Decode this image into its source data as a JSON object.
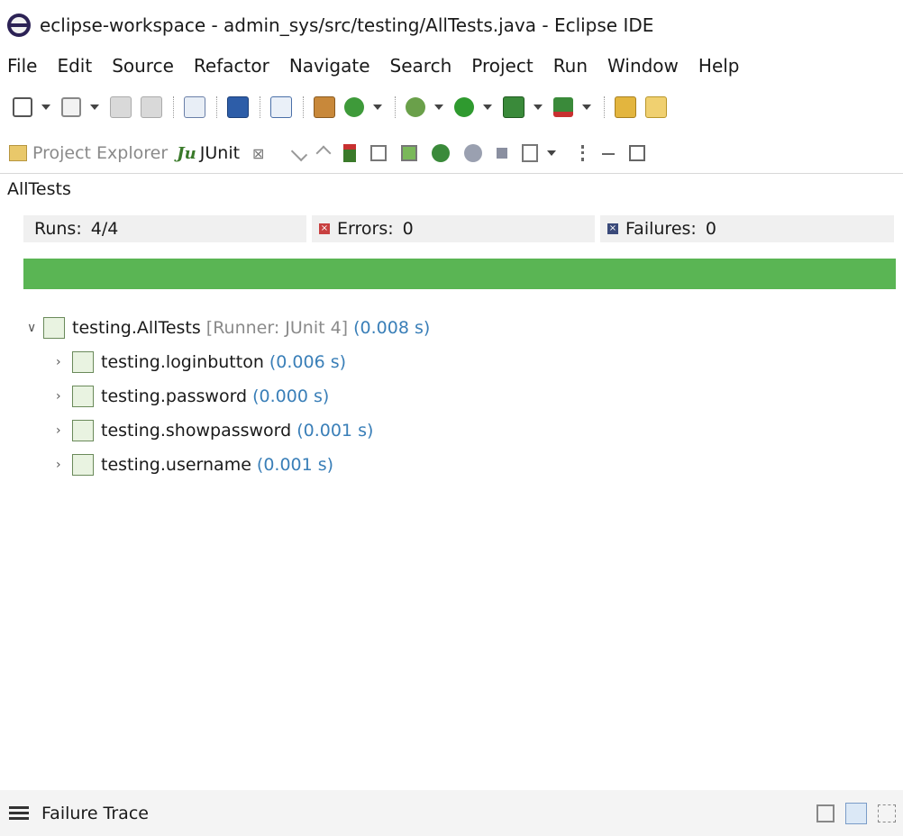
{
  "window": {
    "title": "eclipse-workspace - admin_sys/src/testing/AllTests.java - Eclipse IDE"
  },
  "menu": [
    "File",
    "Edit",
    "Source",
    "Refactor",
    "Navigate",
    "Search",
    "Project",
    "Run",
    "Window",
    "Help"
  ],
  "tabs": {
    "project_explorer": "Project Explorer",
    "junit": "JUnit",
    "close_glyph": "⊠"
  },
  "suite_title": "AllTests",
  "stats": {
    "runs_label": "Runs:",
    "runs_value": "4/4",
    "errors_label": "Errors:",
    "errors_value": "0",
    "failures_label": "Failures:",
    "failures_value": "0"
  },
  "progress": {
    "fraction": 1.0,
    "color": "#5ab554"
  },
  "tree": {
    "root": {
      "name": "testing.AllTests",
      "runner": "[Runner: JUnit 4]",
      "duration": "(0.008 s)"
    },
    "children": [
      {
        "name": "testing.loginbutton",
        "duration": "(0.006 s)"
      },
      {
        "name": "testing.password",
        "duration": "(0.000 s)"
      },
      {
        "name": "testing.showpassword",
        "duration": "(0.001 s)"
      },
      {
        "name": "testing.username",
        "duration": "(0.001 s)"
      }
    ]
  },
  "failure_trace": {
    "label": "Failure Trace"
  }
}
